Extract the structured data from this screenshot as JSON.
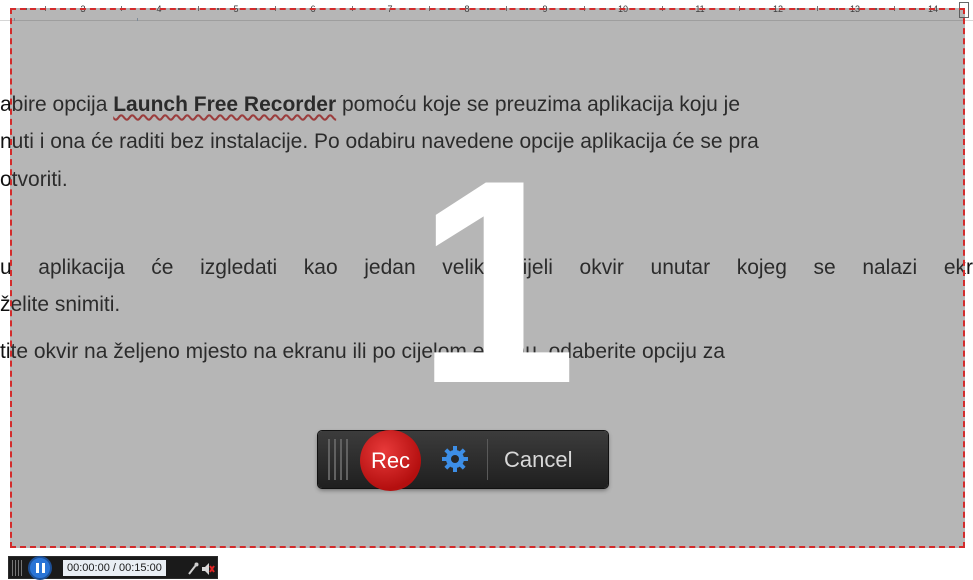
{
  "ruler": {
    "numbers": [
      "3",
      "4",
      "5",
      "6",
      "7",
      "8",
      "9",
      "10",
      "11",
      "12",
      "13",
      "14"
    ]
  },
  "document": {
    "line1": {
      "before": "abire opcija ",
      "bold_link": "Launch Free Recorder",
      "after": " pomoću koje se preuzima aplikacija koju je"
    },
    "line2": "nuti i ona će raditi bez instalacije. Po odabiru navedene opcije aplikacija će se pra",
    "line3": "otvoriti.",
    "line4": "u aplikacija će izgledati kao jedan velik bijeli okvir unutar kojeg se nalazi ekr",
    "line5": "želite snimiti.",
    "line6": "tite okvir na željeno mjesto na ekranu ili po cijelom ekranu, odaberite opciju za"
  },
  "recorder": {
    "countdown": "1",
    "rec_label": "Rec",
    "settings_icon": "gear-icon",
    "cancel_label": "Cancel",
    "frame_color": "#d32b2b",
    "rec_color": "#c81c1c",
    "gear_color": "#3d8ee6"
  },
  "mini_bar": {
    "timer": "00:00:00 / 00:15:00",
    "pause_icon": "pause-icon",
    "mic_icon": "microphone-icon",
    "mute_icon": "speaker-muted-icon"
  }
}
